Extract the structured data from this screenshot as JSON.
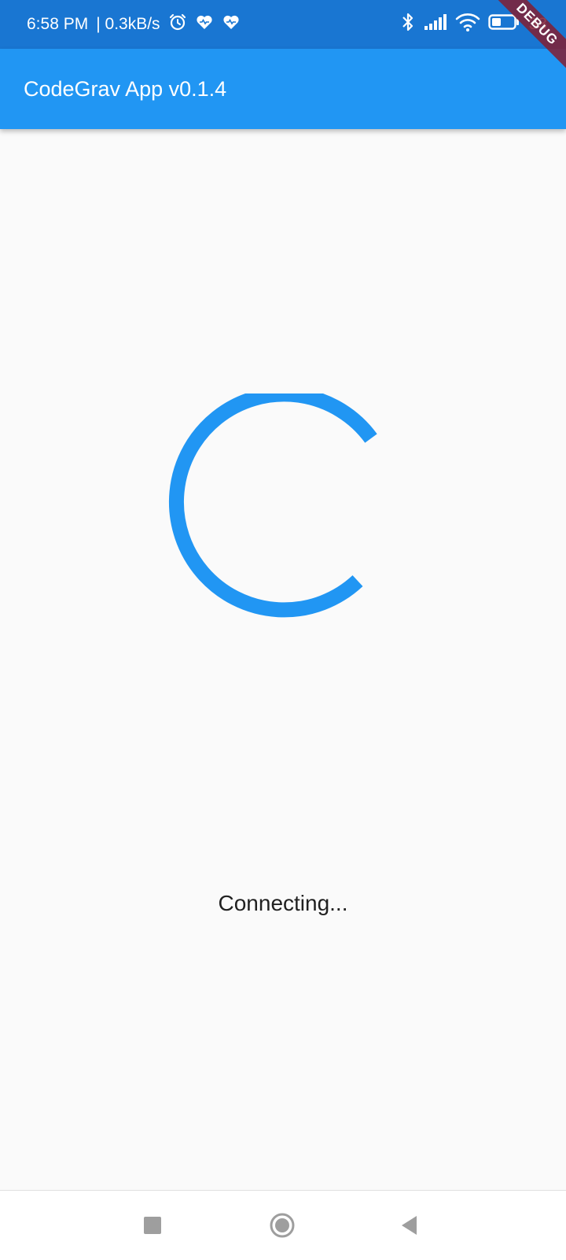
{
  "status_bar": {
    "time": "6:58 PM",
    "speed": "| 0.3kB/s",
    "battery_percent": "33",
    "left_icons": [
      "alarm-icon",
      "heart-monitor-icon",
      "heart-monitor-icon"
    ],
    "right_icons": [
      "bluetooth-icon",
      "signal-icon",
      "wifi-icon",
      "battery-icon"
    ]
  },
  "app_bar": {
    "title": "CodeGrav App v0.1.4",
    "color": "#2196f3"
  },
  "debug_banner": {
    "label": "DEBUG"
  },
  "main": {
    "spinner_color": "#2196f3",
    "status_text": "Connecting..."
  },
  "nav_bar": {
    "buttons": [
      "recents-square-icon",
      "home-circle-icon",
      "back-triangle-icon"
    ]
  }
}
